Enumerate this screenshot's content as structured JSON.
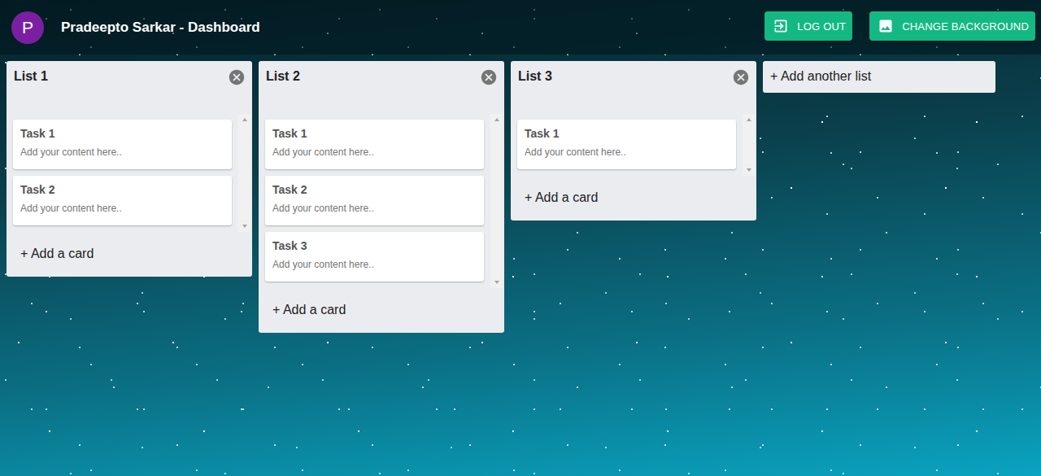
{
  "header": {
    "avatar": "P",
    "title": "Pradeepto Sarkar - Dashboard",
    "buttons": [
      {
        "label": "LOG OUT",
        "kind": "logout"
      },
      {
        "label": "CHANGE BACKGROUND",
        "kind": "background"
      }
    ]
  },
  "lists": [
    {
      "title": "List 1",
      "cards": [
        {
          "title": "Task 1",
          "placeholder": "Add your content here.."
        },
        {
          "title": "Task 2",
          "placeholder": "Add your content here.."
        }
      ],
      "add_card": "+ Add a card"
    },
    {
      "title": "List 2",
      "cards": [
        {
          "title": "Task 1",
          "placeholder": "Add your content here.."
        },
        {
          "title": "Task 2",
          "placeholder": "Add your content here.."
        },
        {
          "title": "Task 3",
          "placeholder": "Add your content here.."
        }
      ],
      "add_card": "+ Add a card"
    },
    {
      "title": "List 3",
      "cards": [
        {
          "title": "Task 1",
          "placeholder": "Add your content here.."
        }
      ],
      "add_card": "+ Add a card"
    }
  ],
  "add_list": "+ Add another list"
}
